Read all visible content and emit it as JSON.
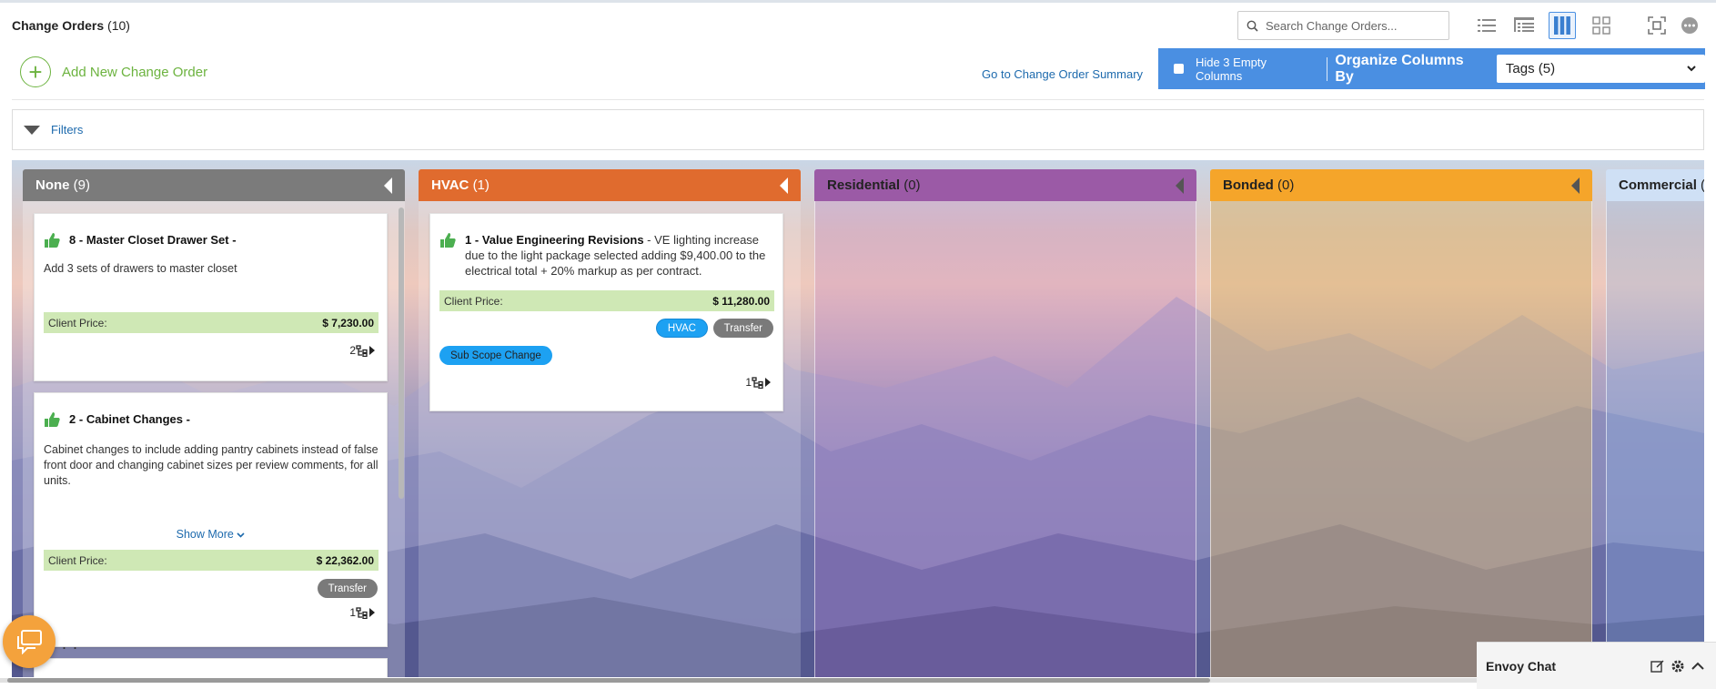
{
  "header": {
    "title": "Change Orders",
    "count": "(10)",
    "search_placeholder": "Search Change Orders...",
    "view_icons": [
      "list-view-icon",
      "grouped-list-icon",
      "board-view-icon",
      "grid-view-icon",
      "fullscreen-icon",
      "more-icon"
    ]
  },
  "toolbar": {
    "add_label": "Add New Change Order",
    "summary_link": "Go to Change Order Summary",
    "hide_empty_label": "Hide 3 Empty Columns",
    "organize_label": "Organize Columns By",
    "organize_value": "Tags (5)"
  },
  "filters": {
    "label": "Filters"
  },
  "columns": [
    {
      "name": "None",
      "count": "(9)",
      "color": "#7b7b7b",
      "cards": [
        {
          "num": "8",
          "title": "Master Closet Drawer Set",
          "sep": " -",
          "desc": "Add 3 sets of drawers to master closet",
          "price_label": "Client Price:",
          "price": "$ 7,230.00",
          "subs": "2"
        },
        {
          "num": "2",
          "title": "Cabinet Changes",
          "sep": " -",
          "desc": "Cabinet changes to include adding pantry cabinets instead of false front door and changing cabinet sizes per review comments, for all units.",
          "show_more": "Show More",
          "price_label": "Client Price:",
          "price": "$ 22,362.00",
          "tag": "Transfer",
          "subs": "1"
        }
      ]
    },
    {
      "name": "HVAC",
      "count": "(1)",
      "color": "#e06b2e",
      "cards": [
        {
          "num": "1",
          "title": "Value Engineering Revisions",
          "sep": " - ",
          "desc": "VE lighting increase due to the light package selected adding $9,400.00 to the electrical total + 20% markup as per contract.",
          "price_label": "Client Price:",
          "price": "$ 11,280.00",
          "tags": [
            "HVAC",
            "Transfer",
            "Sub Scope Change"
          ],
          "subs": "1"
        }
      ]
    },
    {
      "name": "Residential",
      "count": "(0)",
      "color": "#9b5aa6"
    },
    {
      "name": "Bonded",
      "count": "(0)",
      "color": "#f5a52a"
    },
    {
      "name": "Commercial",
      "count": "(",
      "color": "#cfe0f5"
    }
  ],
  "chat": {
    "envoy_label": "Envoy Chat",
    "ellipsis": ". ."
  }
}
